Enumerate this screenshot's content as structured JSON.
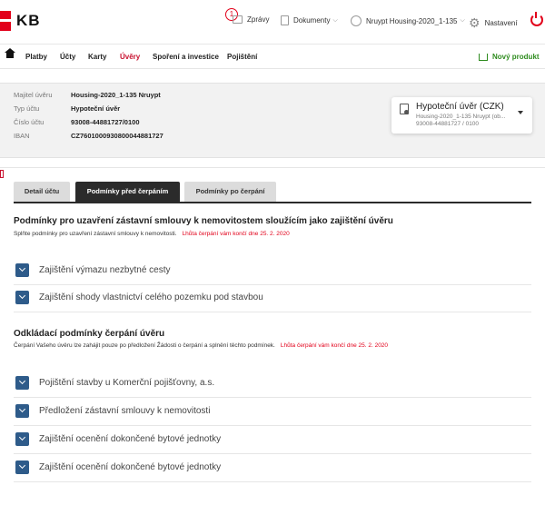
{
  "brand": {
    "name": "KB"
  },
  "header": {
    "messages_count": "1",
    "messages": "Zprávy",
    "documents": "Dokumenty",
    "user": "Nruypt Housing-2020_1-135",
    "settings": "Nastavení"
  },
  "nav": {
    "items": [
      "Platby",
      "Účty",
      "Karty",
      "Úvěry",
      "Spoření a investice",
      "Pojištění"
    ],
    "active": "Úvěry",
    "new_product": "Nový produkt"
  },
  "account": {
    "rows": [
      {
        "label": "Majitel úvěru",
        "value": "Housing-2020_1-135 Nruypt"
      },
      {
        "label": "Typ účtu",
        "value": "Hypoteční úvěr"
      },
      {
        "label": "Číslo účtu",
        "value": "93008-44881727/0100"
      },
      {
        "label": "IBAN",
        "value": "CZ7601000930800044881727"
      }
    ],
    "selector": {
      "title": "Hypoteční úvěr (CZK)",
      "subtitle": "Housing-2020_1-135 Nruypt (ob...",
      "number": "93008-44881727 / 0100"
    }
  },
  "tabs": [
    {
      "label": "Detail účtu",
      "active": false
    },
    {
      "label": "Podmínky před čerpáním",
      "active": true
    },
    {
      "label": "Podmínky po čerpání",
      "active": false
    }
  ],
  "section1": {
    "title": "Podmínky pro uzavření zástavní smlouvy k nemovitostem sloužícím jako zajištění úvěru",
    "note": "Splňte podmínky pro uzavření zástavní smlouvy k nemovitosti.",
    "deadline": "Lhůta čerpání vám končí dne 25. 2. 2020",
    "items": [
      "Zajištění výmazu nezbytné cesty",
      "Zajištění shody vlastnictví celého pozemku pod stavbou"
    ]
  },
  "section2": {
    "title": "Odkládací podmínky čerpání úvěru",
    "note": "Čerpání Vašeho úvěru lze zahájit pouze po předložení Žádosti o čerpání a splnění těchto podmínek.",
    "deadline": "Lhůta čerpání vám končí dne 25. 2. 2020",
    "items": [
      "Pojištění stavby u Komerční pojišťovny, a.s.",
      "Předložení zástavní smlouvy k nemovitosti",
      "Zajištění ocenění dokončené bytové jednotky",
      "Zajištění ocenění dokončené bytové jednotky"
    ]
  },
  "colors": {
    "brand_red": "#e2001a",
    "accent_blue": "#2e5b8a",
    "success_green": "#2e8b1e"
  }
}
